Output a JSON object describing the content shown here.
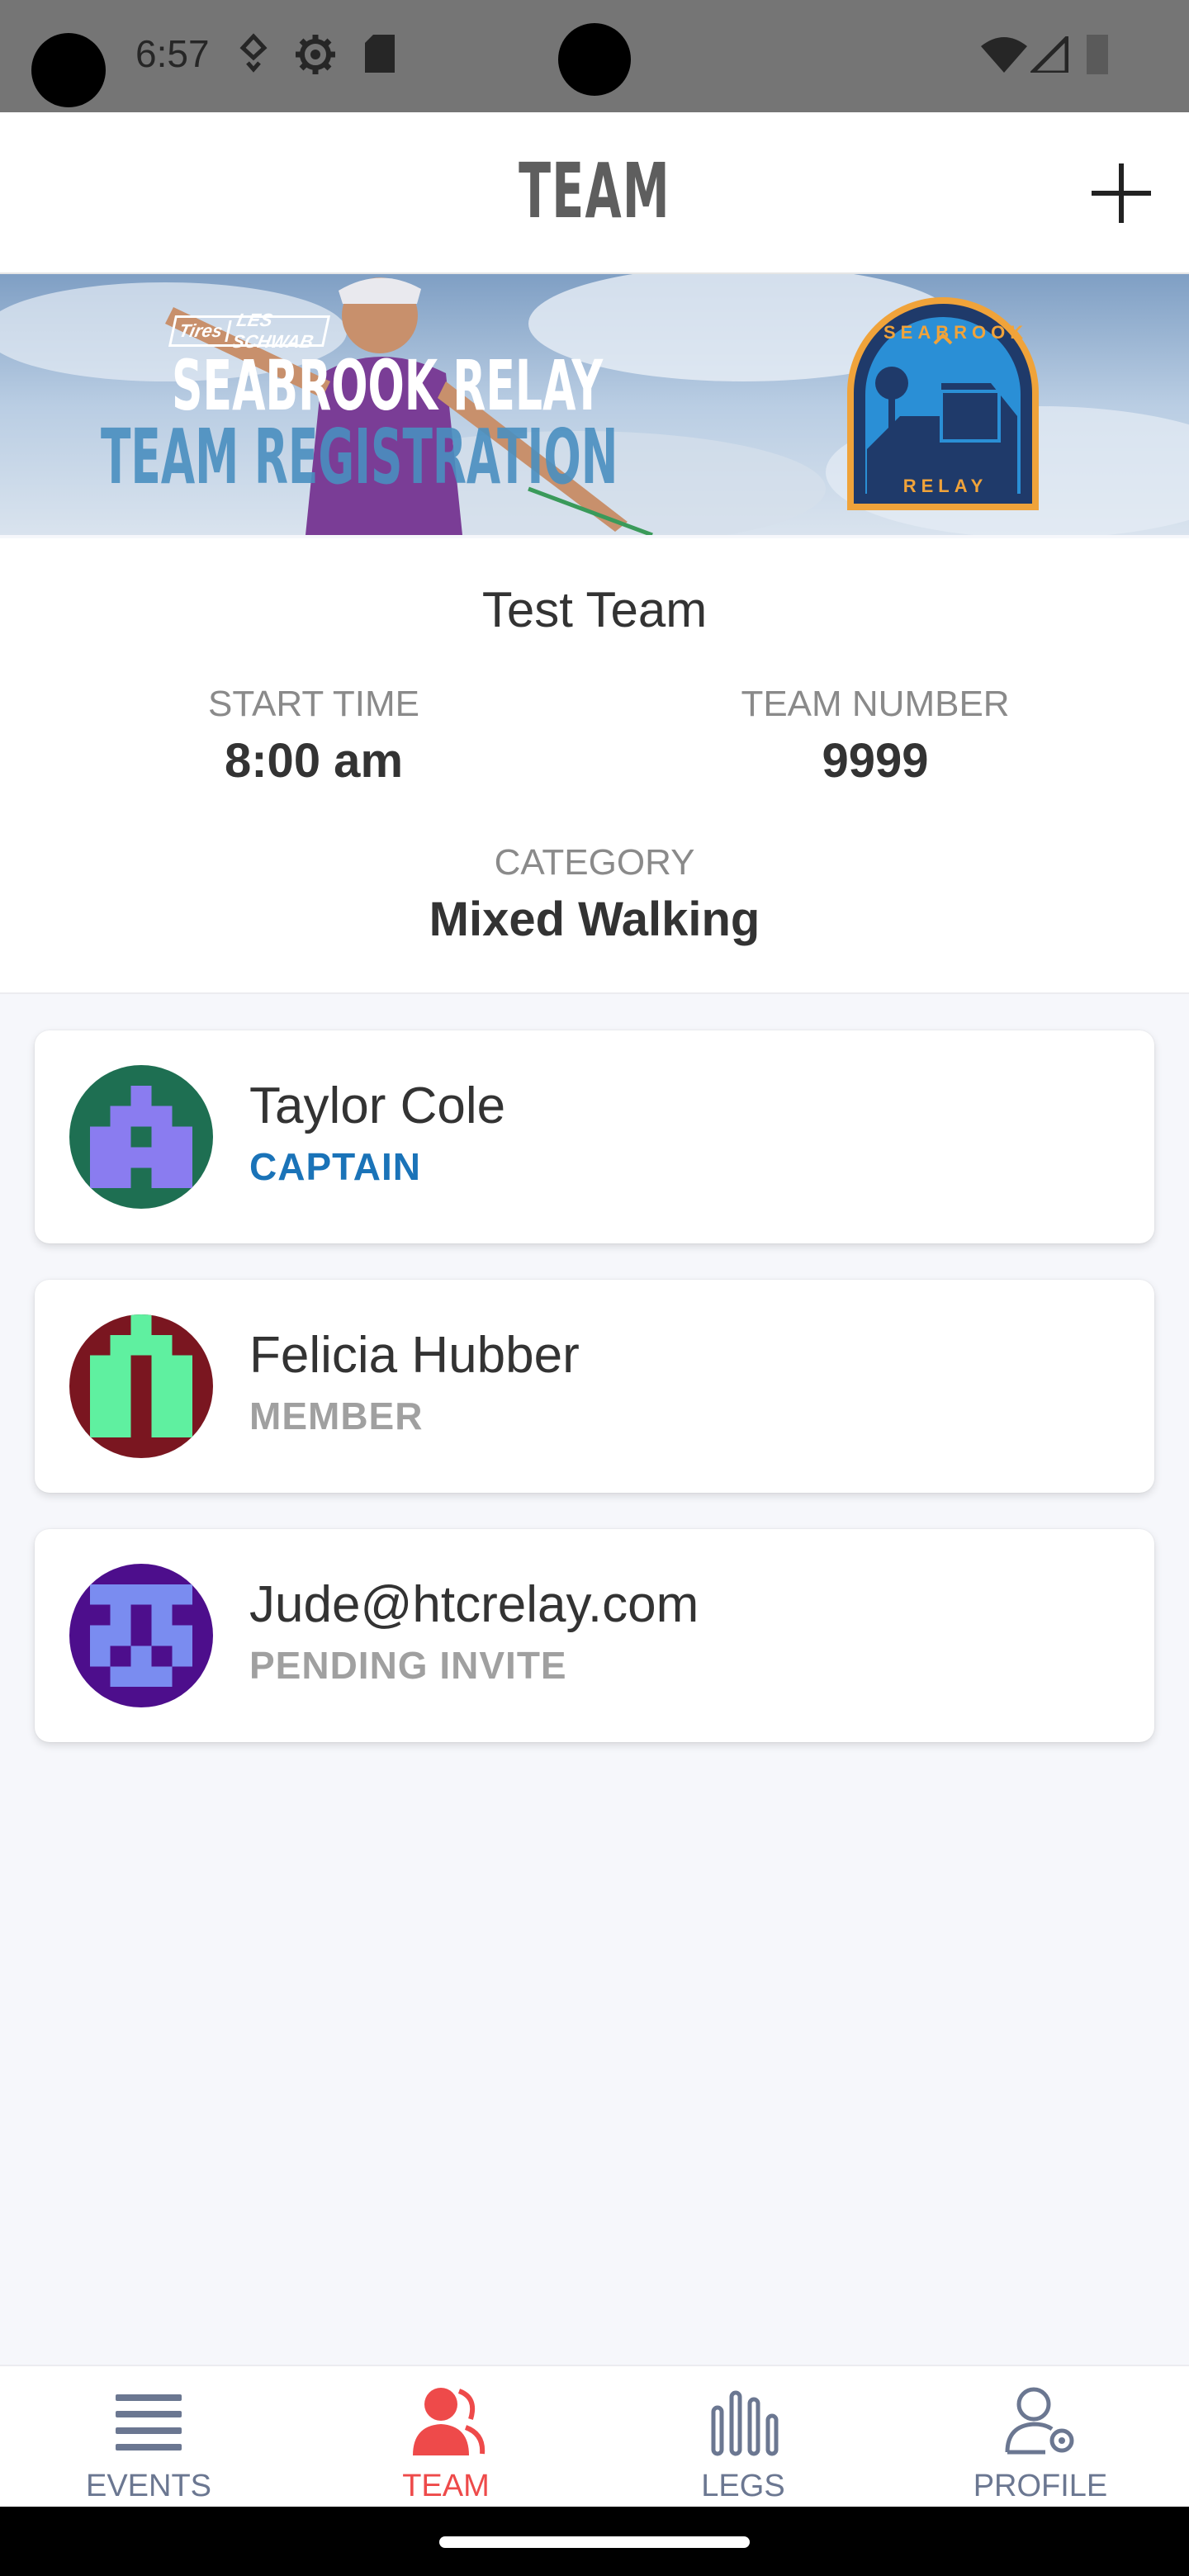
{
  "status_bar": {
    "time": "6:57"
  },
  "app_bar": {
    "title": "TEAM",
    "add_icon": "plus-icon"
  },
  "banner": {
    "sponsor": "LES SCHWAB",
    "sponsor_prefix": "Tires",
    "title_line1": "SEABROOK RELAY",
    "title_line2": "TEAM REGISTRATION",
    "badge_top": "SEABROOK",
    "badge_bottom": "RELAY"
  },
  "team": {
    "name": "Test Team",
    "start_time_label": "START TIME",
    "start_time": "8:00 am",
    "team_number_label": "TEAM NUMBER",
    "team_number": "9999",
    "category_label": "CATEGORY",
    "category": "Mixed Walking"
  },
  "members": [
    {
      "name": "Taylor Cole",
      "role": "CAPTAIN",
      "role_color": "#1a73b8",
      "avatar_bg": "#1e6f52",
      "avatar_fg": "#8a7cf0"
    },
    {
      "name": "Felicia Hubber",
      "role": "MEMBER",
      "role_color": "#a0a0a0",
      "avatar_bg": "#7a1620",
      "avatar_fg": "#5ff0a0"
    },
    {
      "name": "Jude@htcrelay.com",
      "role": "PENDING INVITE",
      "role_color": "#a0a0a0",
      "avatar_bg": "#4d0e8c",
      "avatar_fg": "#7a8cf0"
    }
  ],
  "nav": {
    "events": "EVENTS",
    "team": "TEAM",
    "legs": "LEGS",
    "profile": "PROFILE",
    "active_color": "#ee4a4a",
    "inactive_color": "#6b7791"
  }
}
